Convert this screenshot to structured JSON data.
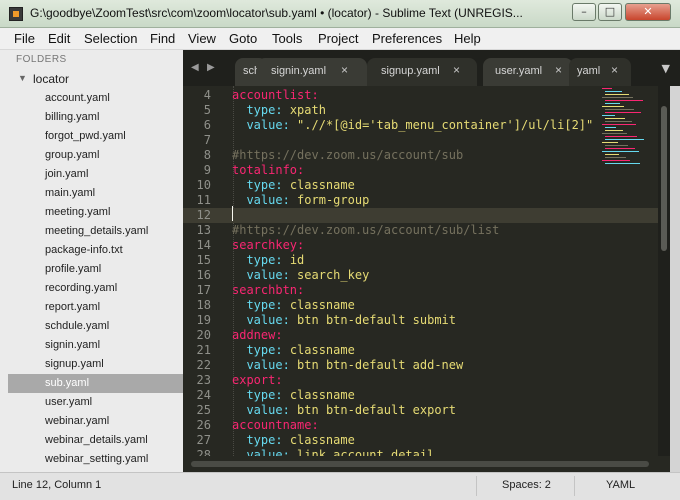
{
  "window": {
    "title": "G:\\goodbye\\ZoomTest\\src\\com\\zoom\\locator\\sub.yaml • (locator) - Sublime Text (UNREGIS...",
    "minimize": "–",
    "maximize": "□",
    "close": "✕"
  },
  "menu": [
    "File",
    "Edit",
    "Selection",
    "Find",
    "View",
    "Goto",
    "Tools",
    "Project",
    "Preferences",
    "Help"
  ],
  "sidebar": {
    "header": "FOLDERS",
    "folder": "locator",
    "files": [
      "account.yaml",
      "billing.yaml",
      "forgot_pwd.yaml",
      "group.yaml",
      "join.yaml",
      "main.yaml",
      "meeting.yaml",
      "meeting_details.yaml",
      "package-info.txt",
      "profile.yaml",
      "recording.yaml",
      "report.yaml",
      "schdule.yaml",
      "signin.yaml",
      "signup.yaml",
      "sub.yaml",
      "user.yaml",
      "webinar.yaml",
      "webinar_details.yaml",
      "webinar_setting.yaml"
    ],
    "selected": "sub.yaml"
  },
  "tabs": {
    "partial": "sch",
    "items": [
      "signin.yaml",
      "signup.yaml",
      "user.yaml"
    ],
    "tail": "yaml",
    "close": "×"
  },
  "editor": {
    "lines": [
      {
        "n": "4",
        "parts": [
          [
            "k",
            "accountlist:"
          ]
        ]
      },
      {
        "n": "5",
        "parts": [
          [
            "t",
            "  "
          ],
          [
            "s",
            "type:"
          ],
          [
            "t",
            " "
          ],
          [
            "v",
            "xpath"
          ]
        ]
      },
      {
        "n": "6",
        "parts": [
          [
            "t",
            "  "
          ],
          [
            "s",
            "value:"
          ],
          [
            "t",
            " "
          ],
          [
            "v",
            "\".//*[@id='tab_menu_container']/ul/li[2]\""
          ]
        ]
      },
      {
        "n": "7",
        "parts": []
      },
      {
        "n": "8",
        "parts": [
          [
            "c",
            "#https://dev.zoom.us/account/sub"
          ]
        ]
      },
      {
        "n": "9",
        "parts": [
          [
            "k",
            "totalinfo:"
          ]
        ]
      },
      {
        "n": "10",
        "parts": [
          [
            "t",
            "  "
          ],
          [
            "s",
            "type:"
          ],
          [
            "t",
            " "
          ],
          [
            "v",
            "classname"
          ]
        ]
      },
      {
        "n": "11",
        "parts": [
          [
            "t",
            "  "
          ],
          [
            "s",
            "value:"
          ],
          [
            "t",
            " "
          ],
          [
            "v",
            "form-group"
          ]
        ]
      },
      {
        "n": "12",
        "parts": []
      },
      {
        "n": "13",
        "parts": [
          [
            "c",
            "#https://dev.zoom.us/account/sub/list"
          ]
        ]
      },
      {
        "n": "14",
        "parts": [
          [
            "k",
            "searchkey:"
          ]
        ]
      },
      {
        "n": "15",
        "parts": [
          [
            "t",
            "  "
          ],
          [
            "s",
            "type:"
          ],
          [
            "t",
            " "
          ],
          [
            "v",
            "id"
          ]
        ]
      },
      {
        "n": "16",
        "parts": [
          [
            "t",
            "  "
          ],
          [
            "s",
            "value:"
          ],
          [
            "t",
            " "
          ],
          [
            "v",
            "search_key"
          ]
        ]
      },
      {
        "n": "17",
        "parts": [
          [
            "k",
            "searchbtn:"
          ]
        ]
      },
      {
        "n": "18",
        "parts": [
          [
            "t",
            "  "
          ],
          [
            "s",
            "type:"
          ],
          [
            "t",
            " "
          ],
          [
            "v",
            "classname"
          ]
        ]
      },
      {
        "n": "19",
        "parts": [
          [
            "t",
            "  "
          ],
          [
            "s",
            "value:"
          ],
          [
            "t",
            " "
          ],
          [
            "v",
            "btn btn-default submit"
          ]
        ]
      },
      {
        "n": "20",
        "parts": [
          [
            "k",
            "addnew:"
          ]
        ]
      },
      {
        "n": "21",
        "parts": [
          [
            "t",
            "  "
          ],
          [
            "s",
            "type:"
          ],
          [
            "t",
            " "
          ],
          [
            "v",
            "classname"
          ]
        ]
      },
      {
        "n": "22",
        "parts": [
          [
            "t",
            "  "
          ],
          [
            "s",
            "value:"
          ],
          [
            "t",
            " "
          ],
          [
            "v",
            "btn btn-default add-new"
          ]
        ]
      },
      {
        "n": "23",
        "parts": [
          [
            "k",
            "export:"
          ]
        ]
      },
      {
        "n": "24",
        "parts": [
          [
            "t",
            "  "
          ],
          [
            "s",
            "type:"
          ],
          [
            "t",
            " "
          ],
          [
            "v",
            "classname"
          ]
        ]
      },
      {
        "n": "25",
        "parts": [
          [
            "t",
            "  "
          ],
          [
            "s",
            "value:"
          ],
          [
            "t",
            " "
          ],
          [
            "v",
            "btn btn-default export"
          ]
        ]
      },
      {
        "n": "26",
        "parts": [
          [
            "k",
            "accountname:"
          ]
        ]
      },
      {
        "n": "27",
        "parts": [
          [
            "t",
            "  "
          ],
          [
            "s",
            "type:"
          ],
          [
            "t",
            " "
          ],
          [
            "v",
            "classname"
          ]
        ]
      },
      {
        "n": "28",
        "parts": [
          [
            "t",
            "  "
          ],
          [
            "s",
            "value:"
          ],
          [
            "t",
            " "
          ],
          [
            "v",
            "link account detail"
          ]
        ]
      }
    ],
    "current_line": "12"
  },
  "status": {
    "position": "Line 12, Column 1",
    "spaces": "Spaces: 2",
    "syntax": "YAML"
  },
  "colors": {
    "key": "#f92672",
    "subkey": "#66d9ef",
    "string": "#e6db74",
    "comment": "#75715e",
    "background": "#272822"
  }
}
